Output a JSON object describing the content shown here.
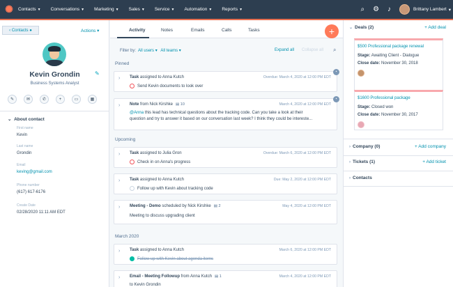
{
  "topbar": {
    "logo": "hubspot-logo",
    "nav": [
      "Contacts",
      "Conversations",
      "Marketing",
      "Sales",
      "Service",
      "Automation",
      "Reports"
    ],
    "user_name": "Brittany Lambert"
  },
  "left": {
    "contacts_label": "Contacts",
    "actions_label": "Actions",
    "name": "Kevin Grondin",
    "title": "Business Systems Analyst",
    "about_label": "About contact",
    "fields": [
      {
        "label": "First name",
        "value": "Kevin",
        "link": false
      },
      {
        "label": "Last name",
        "value": "Grondin",
        "link": false
      },
      {
        "label": "Email",
        "value": "keving@gmail.com",
        "link": true
      },
      {
        "label": "Phone number",
        "value": "(617) 617-6176",
        "link": false
      },
      {
        "label": "Create Date",
        "value": "02/28/2020 11:11 AM EDT",
        "link": false
      }
    ]
  },
  "main": {
    "tabs": [
      "Activity",
      "Notes",
      "Emails",
      "Calls",
      "Tasks"
    ],
    "filter_label": "Filter by:",
    "filter_users": "All users",
    "filter_teams": "All teams",
    "expand_all": "Expand all",
    "collapse_all": "Collapse all",
    "sections": {
      "pinned": "Pinned",
      "upcoming": "Upcoming",
      "march": "March 2020"
    },
    "cards": [
      {
        "type": "Task",
        "rest": "assigned to Anna Kutch",
        "date": "Overdue: March 4, 2020 at 12:00 PM EDT",
        "sub": "Send Kevin documents to look over"
      },
      {
        "type": "Note",
        "rest": "from Nick Kirshke",
        "count": "10",
        "date": "March 4, 2020 at 12:00 PM EDT",
        "mention": "@Anna",
        "note1": " this lead has technical questions about the tracking code. Can you take a look at their",
        "note2": "question and try to answer it based on our conversation last week? I think they could be intereste..."
      },
      {
        "type": "Task",
        "rest": "assigned to Julia Gron",
        "date": "Overdue: March 6, 2020 at 12:00 PM EDT",
        "sub": "Check in on Anna's progress"
      },
      {
        "type": "Task",
        "rest": "assigned to Anna Kutch",
        "date": "Due: May 2, 2020 at 12:00 PM EDT",
        "sub": "Follow up with Kevin about tracking code"
      },
      {
        "type": "Meeting - Demo",
        "rest": "scheduled by Nick Kirshke",
        "count": "2",
        "date": "May 4, 2020 at 12:00 PM EDT",
        "sub": "Meeting to discuss upgrading client"
      },
      {
        "type": "Task",
        "rest": "assigned to Anna Kutch",
        "date": "March 6, 2020 at 12:00 PM EDT",
        "sub": "Follow up with Kevin about agenda items"
      },
      {
        "type": "Email - Meeting Followup",
        "rest": "from Anna Kutch",
        "count": "1",
        "date": "March 4, 2020 at 12:00 PM EDT",
        "sub": "to Kevin Grondin"
      }
    ]
  },
  "right": {
    "deals_label": "Deals (2)",
    "add_deal": "+ Add deal",
    "deals": [
      {
        "title": "$500 Professional package renewal",
        "stage_label": "Stage:",
        "stage": "Awaiting Client - Dialogue",
        "close_label": "Close date:",
        "close": "November 30, 2018"
      },
      {
        "title": "$1600 Professional package",
        "stage_label": "Stage:",
        "stage": "Closed won",
        "close_label": "Close date:",
        "close": "November 30, 2017"
      }
    ],
    "company_label": "Company (0)",
    "add_company": "+ Add company",
    "tickets_label": "Tickets (1)",
    "add_ticket": "+ Add ticket",
    "contacts_label": "Contacts"
  }
}
